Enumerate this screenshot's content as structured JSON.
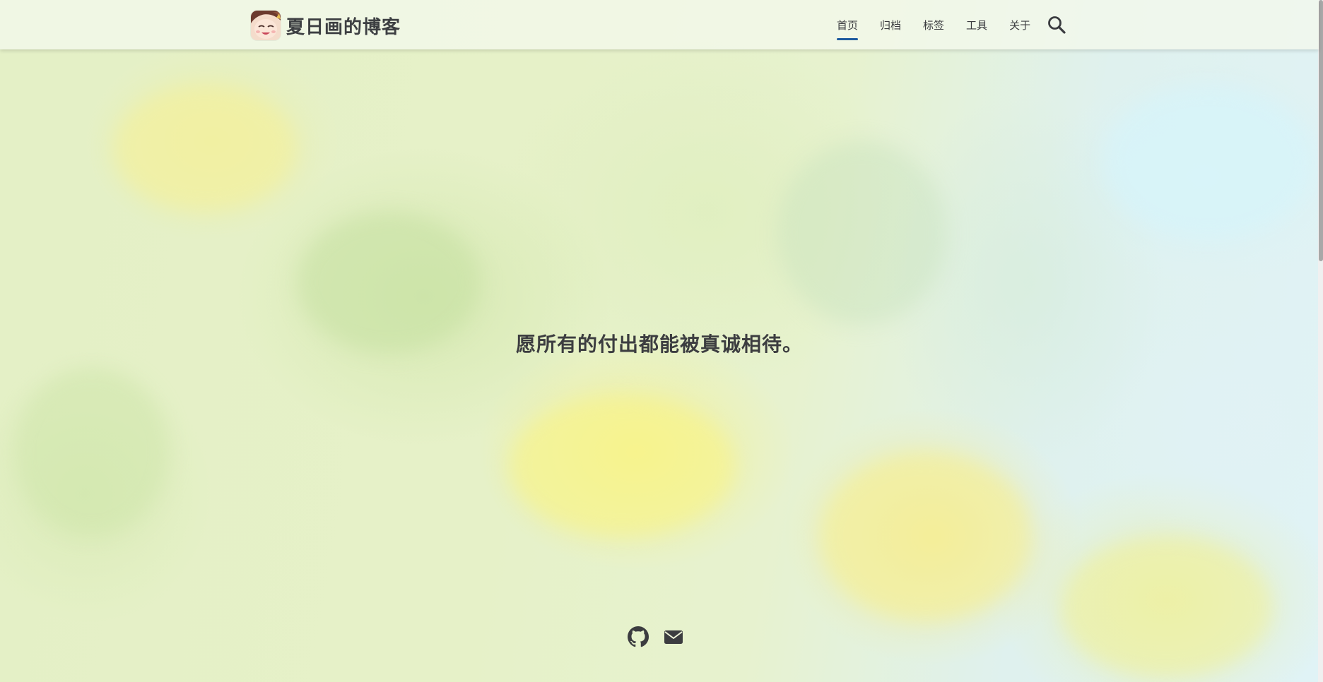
{
  "header": {
    "site_title": "夏日画的博客"
  },
  "nav": {
    "items": [
      {
        "label": "首页",
        "active": true
      },
      {
        "label": "归档",
        "active": false
      },
      {
        "label": "标签",
        "active": false
      },
      {
        "label": "工具",
        "active": false
      },
      {
        "label": "关于",
        "active": false
      }
    ],
    "search_icon": "search-icon",
    "active_color": "#1e5b9f"
  },
  "hero": {
    "slogan": "愿所有的付出都能被真诚相待。"
  },
  "social": {
    "icons": [
      "github-icon",
      "envelope-icon"
    ]
  },
  "colors": {
    "text": "#3c3d40",
    "accent": "#1e5b9f"
  }
}
